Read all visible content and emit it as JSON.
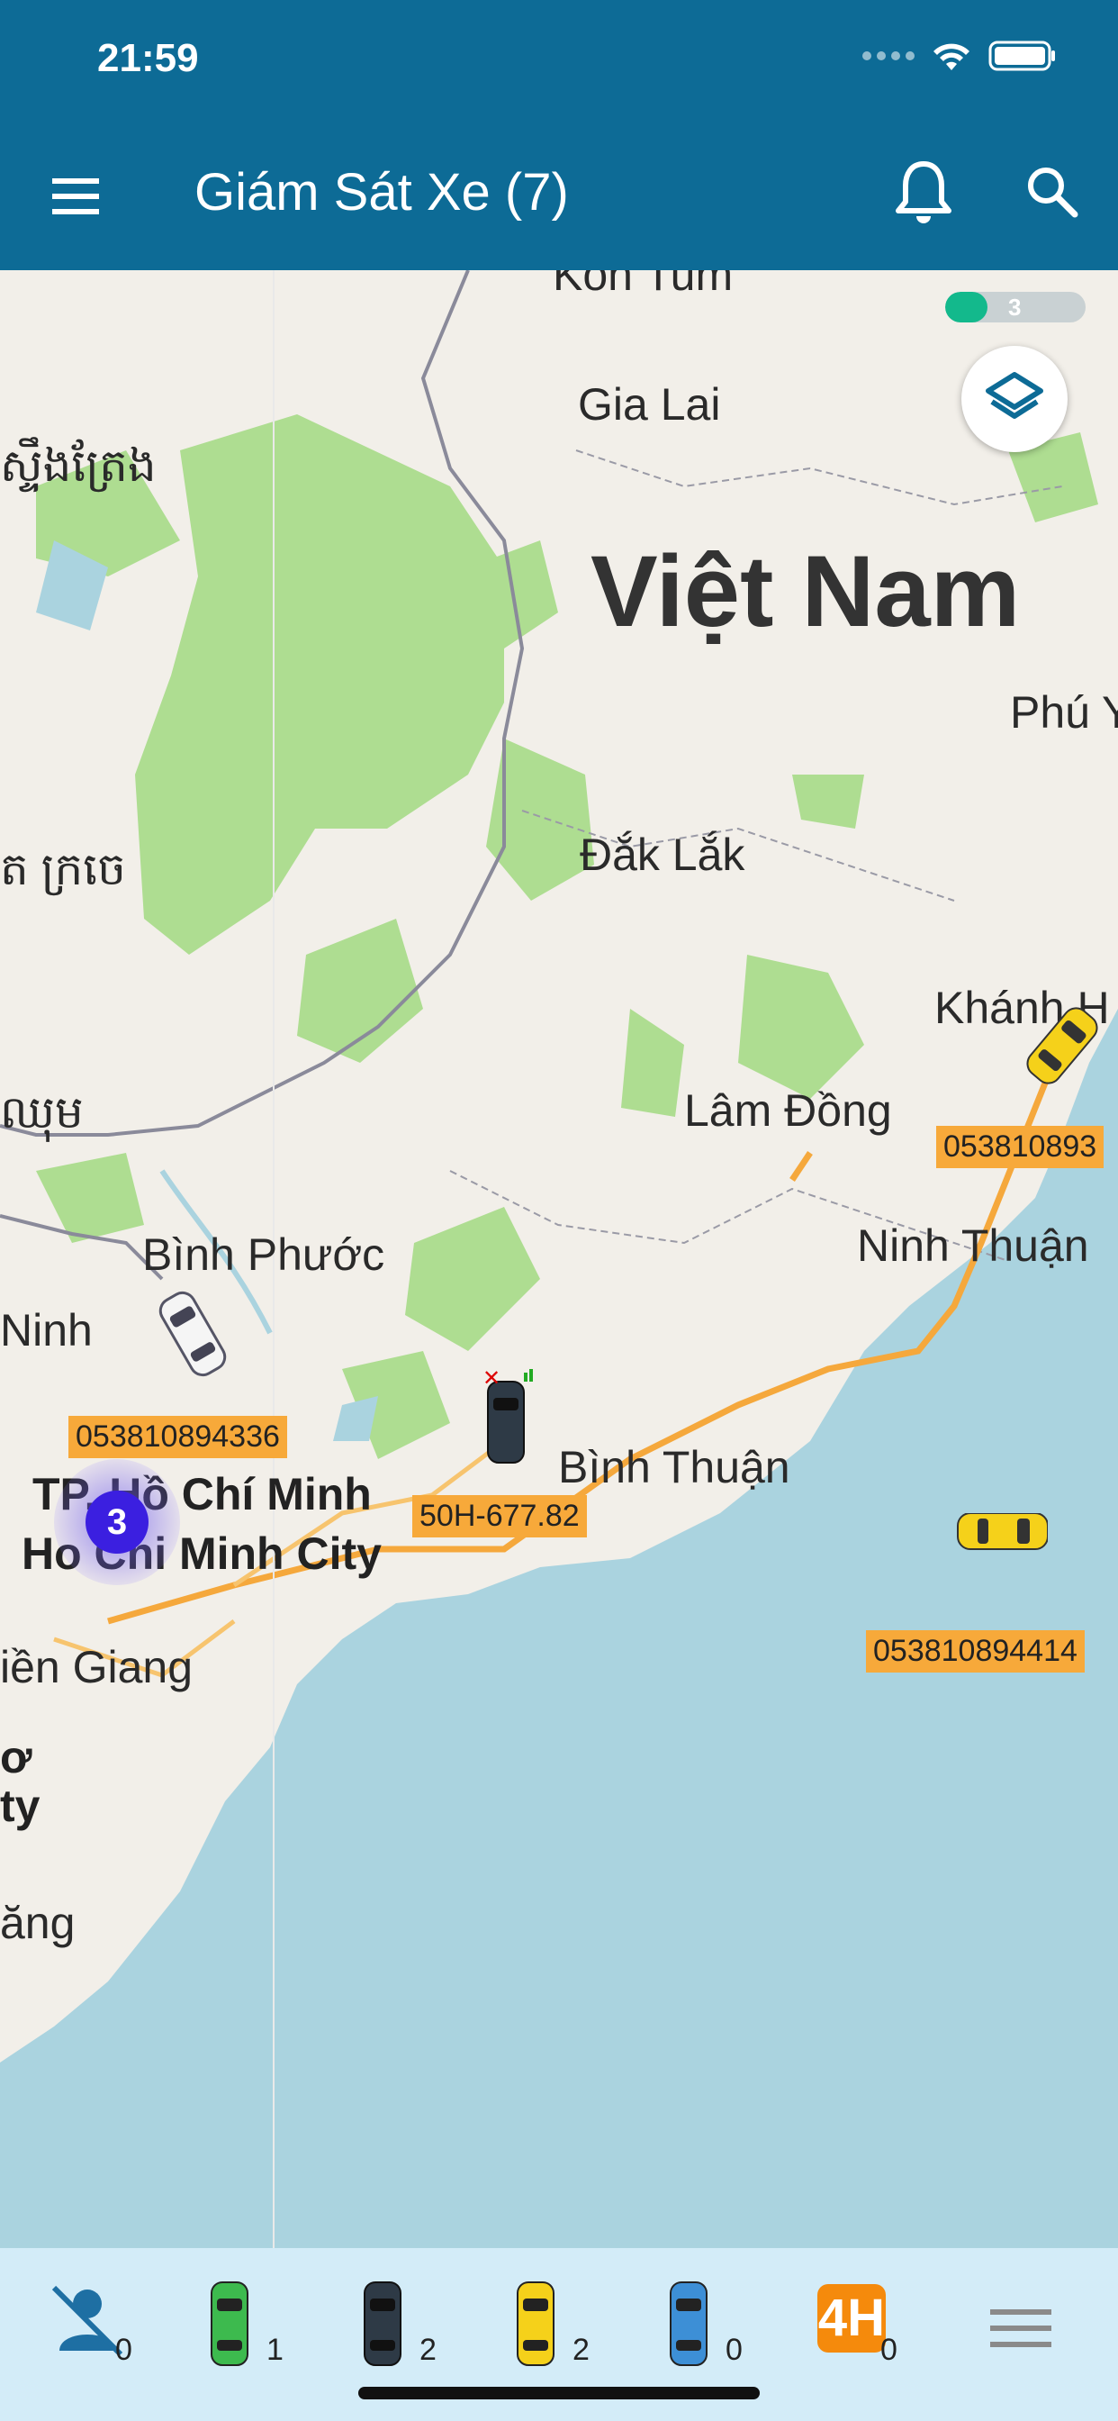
{
  "status": {
    "time": "21:59"
  },
  "appbar": {
    "title": "Giám Sát Xe (7)"
  },
  "map": {
    "loading": {
      "count": "3",
      "progress": 0.3
    },
    "cluster": {
      "count": "3"
    },
    "places": {
      "kon_tum": "Kon Tum",
      "gia_lai": "Gia Lai",
      "khmer_top": "ស្ទឹងត្រែង",
      "viet_nam": "Việt Nam",
      "phu_yen": "Phú Y",
      "dak_lak": "Đắk Lắk",
      "khmer_mid": "ត ក្រចេ",
      "khanh_hoa": "Khánh H",
      "khmer_low": "ឈុម",
      "lam_dong": "Lâm Đồng",
      "binh_phuoc": "Bình Phước",
      "ninh_thuan": "Ninh Thuận",
      "tay_ninh": "Ninh",
      "binh_thuan": "Bình Thuận",
      "hcm_vi": "TP. Hồ Chí Minh",
      "hcm_en": "Ho Chi Minh City",
      "tien_giang": "iền Giang",
      "can_tho_1": "ơ",
      "can_tho_2": "ty",
      "soc_trang": "ăng"
    },
    "plates": {
      "p1": "053810893",
      "p2": "053810894414",
      "p3": "053810894336",
      "p4": "50H-677.82"
    }
  },
  "bottombar": {
    "items": [
      {
        "name": "no-driver",
        "count": "0"
      },
      {
        "name": "running",
        "count": "1"
      },
      {
        "name": "lost-signal",
        "count": "2"
      },
      {
        "name": "stopped",
        "count": "2"
      },
      {
        "name": "parked",
        "count": "0"
      },
      {
        "name": "over-4h",
        "count": "0",
        "badge": "4H"
      }
    ]
  },
  "colors": {
    "appbar": "#0d6b96",
    "bottombar": "#d3ecf8",
    "plate": "#f7a93a",
    "sea": "#aad3df",
    "land": "#f2efe9",
    "forest": "#aedd91"
  }
}
